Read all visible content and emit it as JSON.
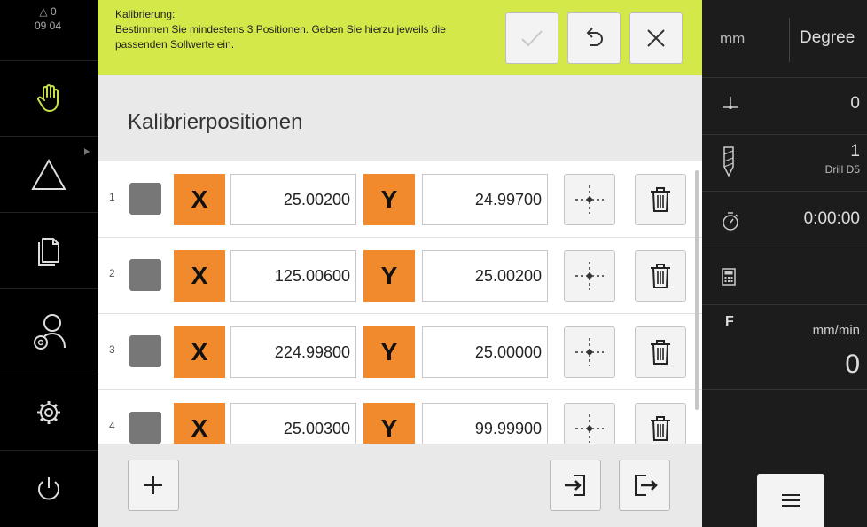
{
  "status": {
    "triangle_count": "△ 0",
    "time": "09 04"
  },
  "message": {
    "title": "Kalibrierung:",
    "text": "Bestimmen Sie mindestens 3 Positionen. Geben Sie hierzu jeweils die passenden Sollwerte ein."
  },
  "content": {
    "title": "Kalibrierpositionen",
    "rows": [
      {
        "index": "1",
        "x_label": "X",
        "x_value": "25.00200",
        "y_label": "Y",
        "y_value": "24.99700"
      },
      {
        "index": "2",
        "x_label": "X",
        "x_value": "125.00600",
        "y_label": "Y",
        "y_value": "25.00200"
      },
      {
        "index": "3",
        "x_label": "X",
        "x_value": "224.99800",
        "y_label": "Y",
        "y_value": "25.00000"
      },
      {
        "index": "4",
        "x_label": "X",
        "x_value": "25.00300",
        "y_label": "Y",
        "y_value": "99.99900"
      }
    ]
  },
  "right": {
    "unit_linear": "mm",
    "unit_angle": "Degree",
    "datum_value": "0",
    "tool_number": "1",
    "tool_name": "Drill D5",
    "timer": "0:00:00",
    "feed_label": "F",
    "feed_unit": "mm/min",
    "feed_value": "0"
  },
  "colors": {
    "message_bg": "#d4e84a",
    "axis_orange": "#f08a2c",
    "nav_bg": "#000000",
    "right_bg": "#1c1c1c"
  }
}
